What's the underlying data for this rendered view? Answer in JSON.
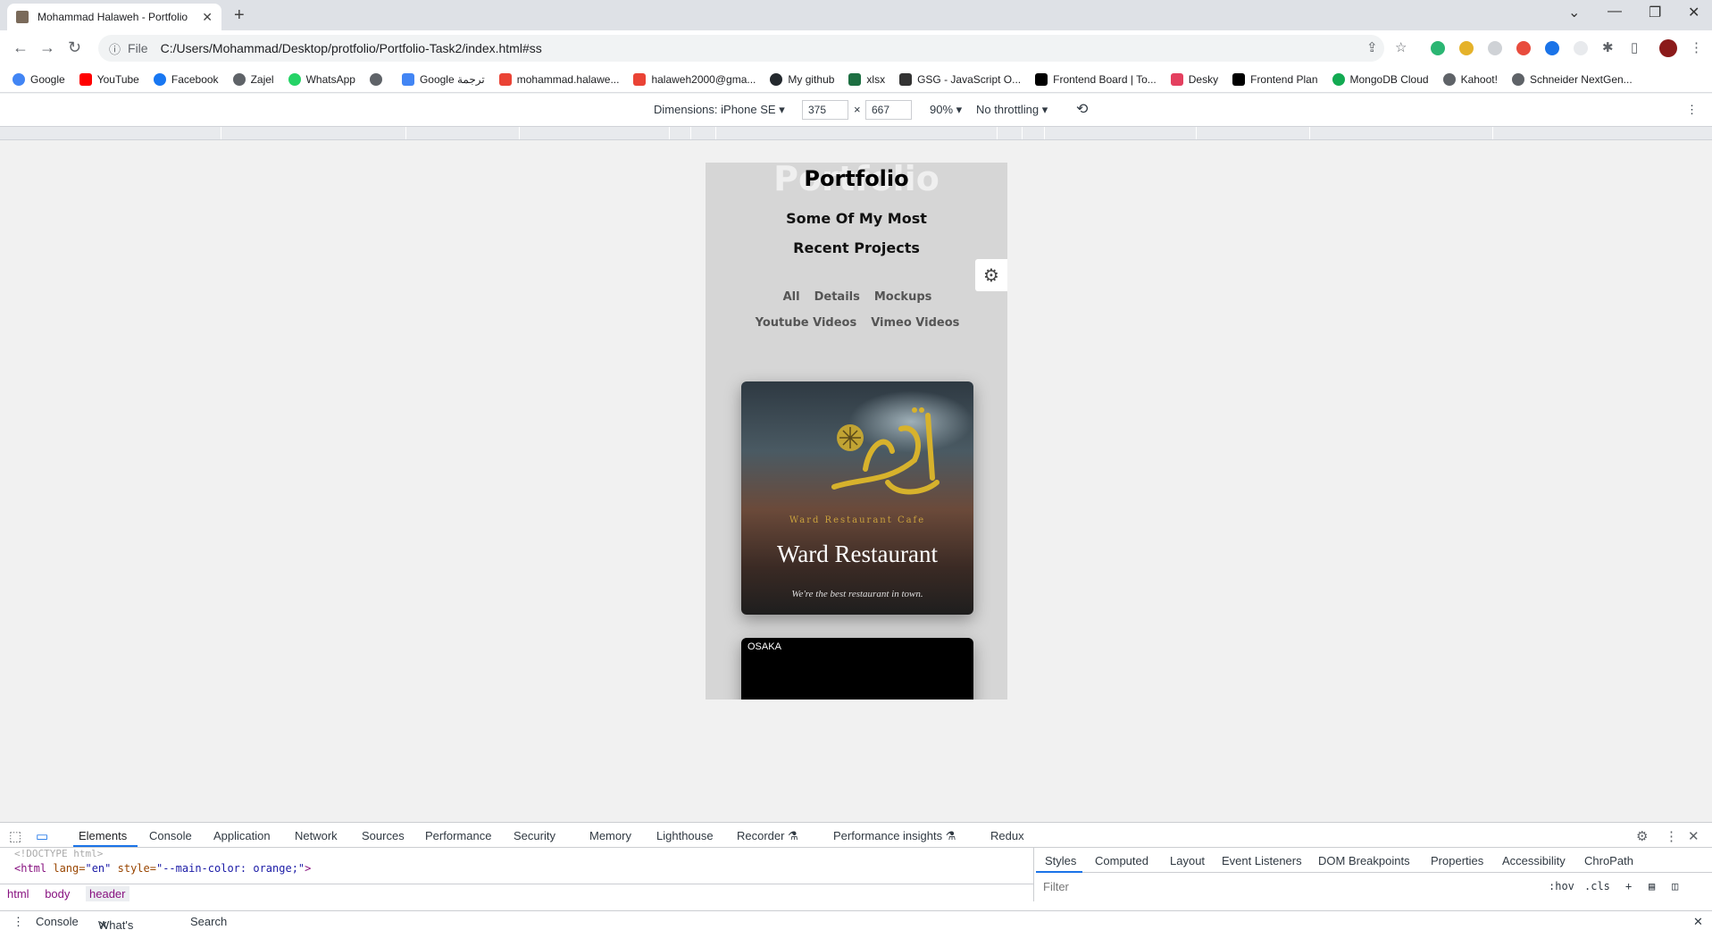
{
  "browser": {
    "tab_title": "Mohammad Halaweh - Portfolio",
    "url_scheme": "File",
    "url": "C:/Users/Mohammad/Desktop/protfolio/Portfolio-Task2/index.html#ss"
  },
  "bookmarks": [
    {
      "label": "Google",
      "icon": "google-icon",
      "color": "#4285f4"
    },
    {
      "label": "YouTube",
      "icon": "youtube-icon",
      "color": "#ff0000"
    },
    {
      "label": "Facebook",
      "icon": "facebook-icon",
      "color": "#1877f2"
    },
    {
      "label": "Zajel",
      "icon": "globe-icon",
      "color": "#5f6368"
    },
    {
      "label": "WhatsApp",
      "icon": "whatsapp-icon",
      "color": "#25d366"
    },
    {
      "label": "",
      "icon": "globe-icon",
      "color": "#5f6368"
    },
    {
      "label": "Google ترجمة",
      "icon": "translate-icon",
      "color": "#4285f4"
    },
    {
      "label": "mohammad.halawe...",
      "icon": "gmail-icon",
      "color": "#ea4335"
    },
    {
      "label": "halaweh2000@gma...",
      "icon": "gmail-icon",
      "color": "#ea4335"
    },
    {
      "label": "My github",
      "icon": "github-icon",
      "color": "#24292e"
    },
    {
      "label": "xlsx",
      "icon": "excel-icon",
      "color": "#1d6f42"
    },
    {
      "label": "GSG - JavaScript O...",
      "icon": "gsg-icon",
      "color": "#333333"
    },
    {
      "label": "Frontend Board | To...",
      "icon": "notion-icon",
      "color": "#000000"
    },
    {
      "label": "Desky",
      "icon": "desky-icon",
      "color": "#e4405f"
    },
    {
      "label": "Frontend Plan",
      "icon": "notion-icon",
      "color": "#000000"
    },
    {
      "label": "MongoDB Cloud",
      "icon": "mongodb-icon",
      "color": "#13aa52"
    },
    {
      "label": "Kahoot!",
      "icon": "globe-icon",
      "color": "#5f6368"
    },
    {
      "label": "Schneider NextGen...",
      "icon": "globe-icon",
      "color": "#5f6368"
    }
  ],
  "device_toolbar": {
    "dimensions": "Dimensions: iPhone SE",
    "width": "375",
    "times": "×",
    "height": "667",
    "zoom": "90%",
    "throttling": "No throttling"
  },
  "page": {
    "ghost_title": "Portfolio",
    "title": "Portfolio",
    "subtitle": "Some Of My Most Recent Projects",
    "filters_row1": [
      "All",
      "Details",
      "Mockups"
    ],
    "filters_row2": [
      "Youtube Videos",
      "Vimeo Videos"
    ],
    "card1": {
      "tagline": "Ward Restaurant Cafe",
      "name": "Ward Restaurant",
      "slogan": "We're the best restaurant in town."
    },
    "card2": {
      "label": "OSAKA"
    }
  },
  "devtools": {
    "tabs": [
      "Elements",
      "Console",
      "Application",
      "Network",
      "Sources",
      "Performance",
      "Security",
      "Memory",
      "Lighthouse",
      "Recorder",
      "Performance insights",
      "Redux"
    ],
    "code_line1": "<!DOCTYPE html>",
    "code_tag": "<html",
    "code_attr1": "lang=",
    "code_val1": "\"en\"",
    "code_attr2": "style=",
    "code_val2": "\"--main-color: orange;\"",
    "code_close": ">",
    "breadcrumbs": [
      "html",
      "body",
      "header"
    ],
    "styles_tabs": [
      "Styles",
      "Computed",
      "Layout",
      "Event Listeners",
      "DOM Breakpoints",
      "Properties",
      "Accessibility",
      "ChroPath"
    ],
    "filter_placeholder": "Filter",
    "hov": ":hov",
    "cls": ".cls",
    "drawer_tabs": [
      "Console",
      "What's New",
      "Search"
    ]
  }
}
